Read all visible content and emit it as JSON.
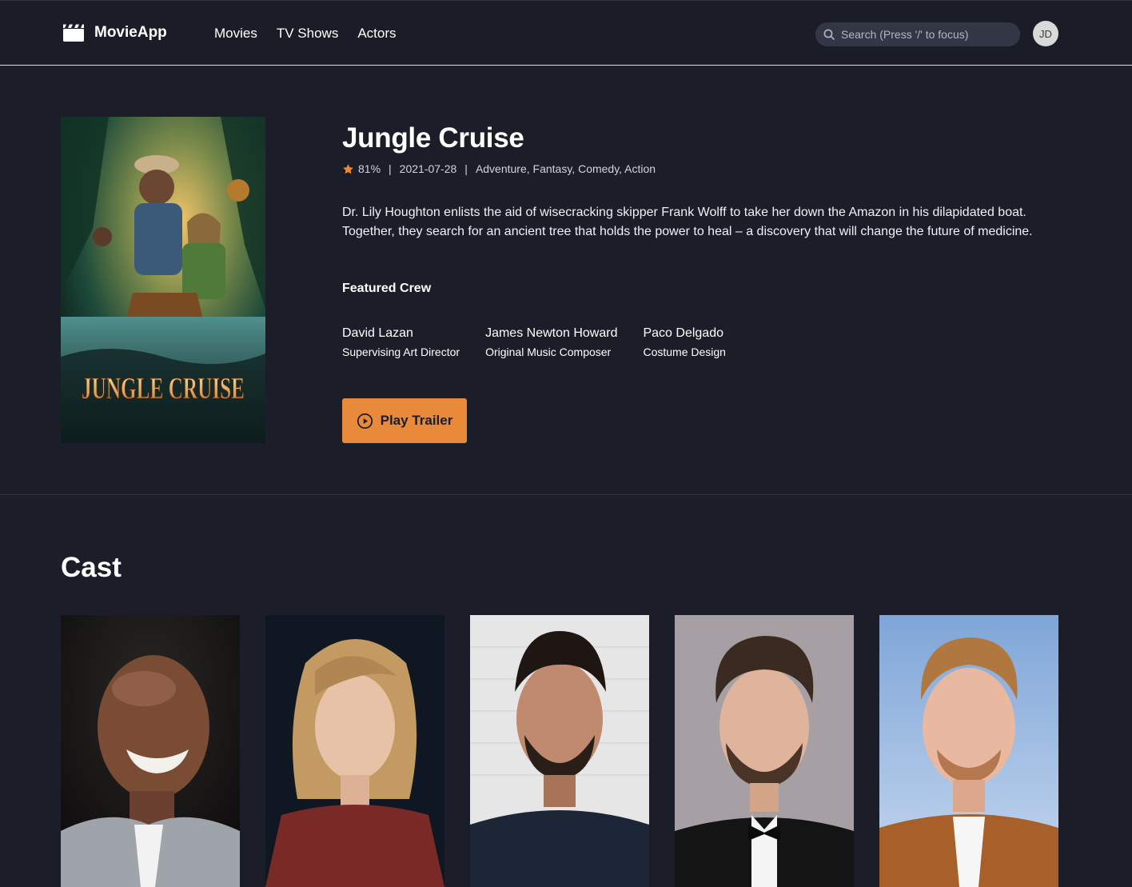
{
  "header": {
    "brand": "MovieApp",
    "nav": [
      "Movies",
      "TV Shows",
      "Actors"
    ],
    "search_placeholder": "Search (Press '/' to focus)",
    "avatar_initials": "JD"
  },
  "movie": {
    "title": "Jungle Cruise",
    "rating": "81%",
    "release_date": "2021-07-28",
    "genres": "Adventure, Fantasy, Comedy, Action",
    "separator": "|",
    "overview": "Dr. Lily Houghton enlists the aid of wisecracking skipper Frank Wolff to take her down the Amazon in his dilapidated boat. Together, they search for an ancient tree that holds the power to heal – a discovery that will change the future of medicine.",
    "poster_title": "JUNGLE CRUISE"
  },
  "crew": {
    "heading": "Featured Crew",
    "members": [
      {
        "name": "David Lazan",
        "job": "Supervising Art Director"
      },
      {
        "name": "James Newton Howard",
        "job": "Original Music Composer"
      },
      {
        "name": "Paco Delgado",
        "job": "Costume Design"
      }
    ]
  },
  "actions": {
    "play_trailer": "Play Trailer"
  },
  "cast": {
    "heading": "Cast",
    "photo_count": 5
  },
  "icons": {
    "brand": "clapperboard-icon",
    "search": "search-icon",
    "rating": "star-icon",
    "play": "play-circle-icon"
  },
  "colors": {
    "background": "#1b1e29",
    "accent": "#e88a3a",
    "star": "#e88a3a",
    "search_bg": "#333745"
  }
}
